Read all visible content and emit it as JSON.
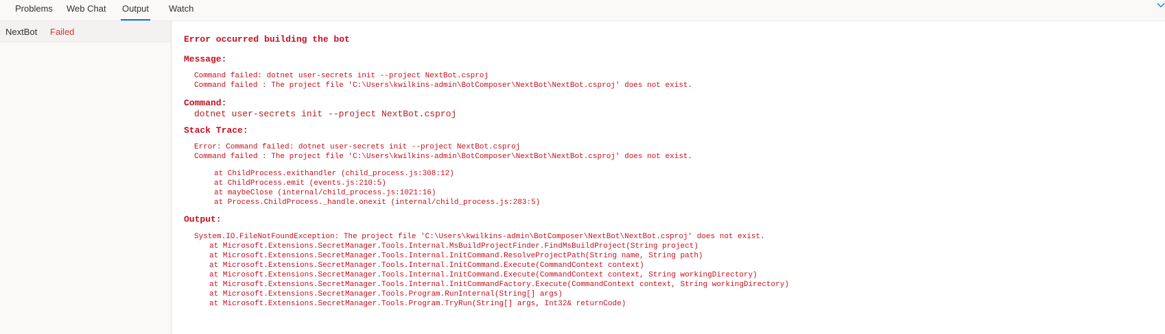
{
  "tabs": {
    "problems": "Problems",
    "webchat": "Web Chat",
    "output": "Output",
    "watch": "Watch"
  },
  "sidebar": {
    "bot_name": "NextBot",
    "bot_status": "Failed"
  },
  "log": {
    "title": "Error occurred building the bot",
    "message_heading": "Message:",
    "message_lines": [
      "Command failed: dotnet user-secrets init --project NextBot.csproj",
      "Command failed : The project file 'C:\\Users\\kwilkins-admin\\BotComposer\\NextBot\\NextBot.csproj' does not exist."
    ],
    "command_heading": "Command:",
    "command": "dotnet user-secrets init --project NextBot.csproj",
    "stack_heading": "Stack Trace:",
    "stack_lines": [
      "Error: Command failed: dotnet user-secrets init --project NextBot.csproj",
      "Command failed : The project file 'C:\\Users\\kwilkins-admin\\BotComposer\\NextBot\\NextBot.csproj' does not exist."
    ],
    "stack_frames": [
      "at ChildProcess.exithandler (child_process.js:308:12)",
      "at ChildProcess.emit (events.js:210:5)",
      "at maybeClose (internal/child_process.js:1021:16)",
      "at Process.ChildProcess._handle.onexit (internal/child_process.js:283:5)"
    ],
    "output_heading": "Output:",
    "output_exception": "System.IO.FileNotFoundException: The project file 'C:\\Users\\kwilkins-admin\\BotComposer\\NextBot\\NextBot.csproj' does not exist.",
    "output_frames": [
      "at Microsoft.Extensions.SecretManager.Tools.Internal.MsBuildProjectFinder.FindMsBuildProject(String project)",
      "at Microsoft.Extensions.SecretManager.Tools.Internal.InitCommand.ResolveProjectPath(String name, String path)",
      "at Microsoft.Extensions.SecretManager.Tools.Internal.InitCommand.Execute(CommandContext context)",
      "at Microsoft.Extensions.SecretManager.Tools.Internal.InitCommand.Execute(CommandContext context, String workingDirectory)",
      "at Microsoft.Extensions.SecretManager.Tools.Internal.InitCommandFactory.Execute(CommandContext context, String workingDirectory)",
      "at Microsoft.Extensions.SecretManager.Tools.Program.RunInternal(String[] args)",
      "at Microsoft.Extensions.SecretManager.Tools.Program.TryRun(String[] args, Int32& returnCode)"
    ]
  },
  "icons": {
    "collapse": "chevron-down-icon"
  },
  "colors": {
    "accent": "#0078d4",
    "error": "#c50f1f",
    "failed": "#d13438"
  }
}
